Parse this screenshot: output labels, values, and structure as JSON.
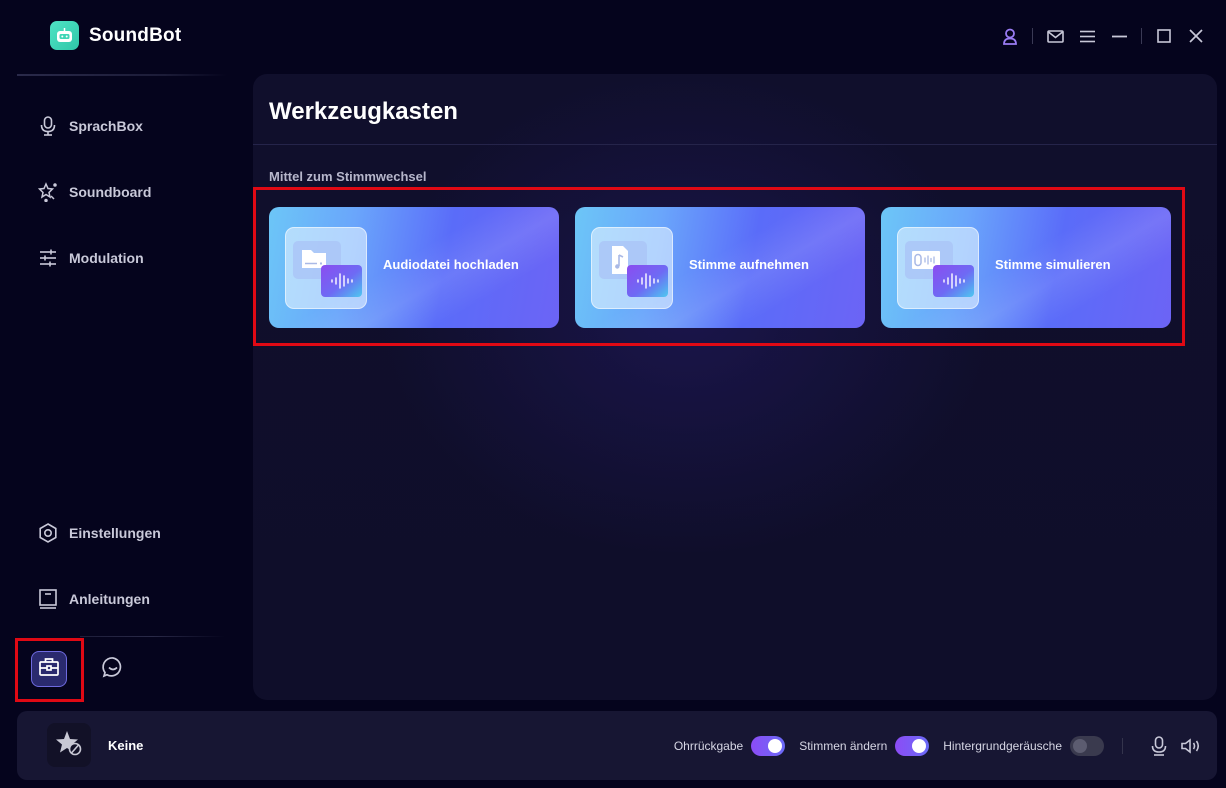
{
  "app": {
    "name": "SoundBot",
    "icon": "robot-icon",
    "brand_color": "#3fd6b6"
  },
  "window_controls": [
    {
      "name": "account",
      "icon": "user-icon",
      "color": "#9a7cf4"
    },
    {
      "name": "mail",
      "icon": "mail-icon"
    },
    {
      "name": "menu",
      "icon": "hamburger-menu-icon"
    },
    {
      "name": "minimize",
      "icon": "minimize-icon"
    },
    {
      "name": "maximize",
      "icon": "maximize-icon"
    },
    {
      "name": "close",
      "icon": "close-icon"
    }
  ],
  "sidebar": {
    "top_items": [
      {
        "label": "SprachBox",
        "icon": "microphone-icon"
      },
      {
        "label": "Soundboard",
        "icon": "magic-star-icon"
      },
      {
        "label": "Modulation",
        "icon": "sliders-icon"
      }
    ],
    "bottom_items": [
      {
        "label": "Einstellungen",
        "icon": "settings-icon"
      },
      {
        "label": "Anleitungen",
        "icon": "book-icon"
      }
    ],
    "toolbox_button": {
      "icon": "toolbox-icon",
      "active": true
    },
    "chat_button": {
      "icon": "chat-icon"
    }
  },
  "main": {
    "title": "Werkzeugkasten",
    "section_label": "Mittel zum Stimmwechsel",
    "cards": [
      {
        "label": "Audiodatei hochladen",
        "icon": "folder-audio-icon"
      },
      {
        "label": "Stimme aufnehmen",
        "icon": "music-file-audio-icon"
      },
      {
        "label": "Stimme simulieren",
        "icon": "voice-simulate-icon"
      }
    ]
  },
  "bottom_bar": {
    "voice_name": "Keine",
    "voice_icon": "no-voice-star-icon",
    "toggles": [
      {
        "label": "Ohrrückgabe",
        "on": true
      },
      {
        "label": "Stimmen ändern",
        "on": true
      },
      {
        "label": "Hintergrundgeräusche",
        "on": false
      }
    ],
    "mic_icon": "microphone-icon",
    "speaker_icon": "speaker-icon"
  },
  "annotations": {
    "highlight_color": "#e00914"
  }
}
